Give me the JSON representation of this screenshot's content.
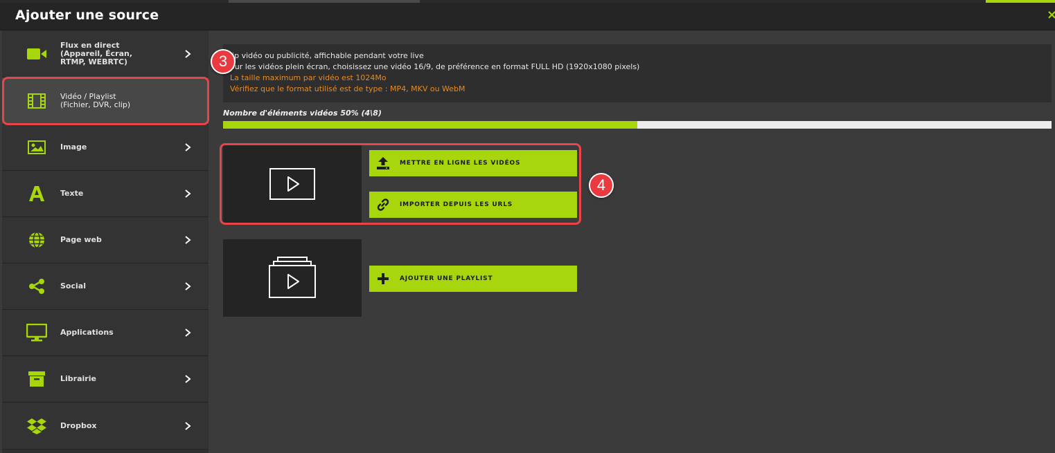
{
  "modal": {
    "title": "Ajouter une source",
    "close_label": "×"
  },
  "colors": {
    "accent": "#a7d60d",
    "warning_text": "#e68a25",
    "highlight": "#e8444a"
  },
  "sidebar": {
    "items": [
      {
        "label": "Flux en direct\n(Appareil, Écran,\nRTMP, WEBRTC)",
        "icon": "video-camera-icon"
      },
      {
        "label": "Vidéo / Playlist\n(Fichier, DVR, clip)",
        "icon": "film-icon",
        "active": true
      },
      {
        "label": "Image",
        "icon": "image-icon"
      },
      {
        "label": "Texte",
        "icon": "text-icon"
      },
      {
        "label": "Page web",
        "icon": "globe-icon"
      },
      {
        "label": "Social",
        "icon": "share-icon"
      },
      {
        "label": "Applications",
        "icon": "monitor-icon"
      },
      {
        "label": "Librairie",
        "icon": "archive-icon"
      },
      {
        "label": "Dropbox",
        "icon": "dropbox-icon"
      }
    ]
  },
  "info": {
    "line1": "lip vidéo ou publicité, affichable pendant votre live",
    "line2": "our les vidéos plein écran, choisissez une vidéo 16/9, de préférence en format FULL HD (1920x1080 pixels)",
    "line3": "La taille maximum par vidéo est 1024Mo",
    "line4": "Vérifiez que le format utilisé est de type : MP4, MKV ou WebM"
  },
  "progress": {
    "label": "Nombre d'éléments vidéos 50% (4\\8)",
    "percent": 50
  },
  "actions": {
    "upload_label": "METTRE EN LIGNE LES VIDÉOS",
    "import_label": "IMPORTER DEPUIS LES URLS",
    "playlist_label": "AJOUTER UNE PLAYLIST"
  },
  "annotations": {
    "step3": "3",
    "step4": "4"
  }
}
